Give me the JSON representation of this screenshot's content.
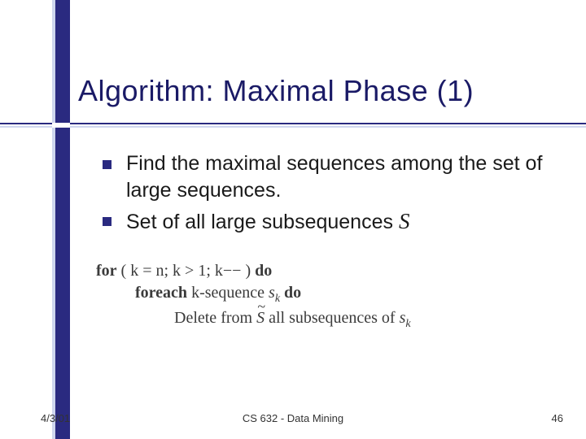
{
  "title": "Algorithm: Maximal Phase (1)",
  "bullets": [
    {
      "text": "Find the maximal sequences among the set of large sequences."
    },
    {
      "text_prefix": "Set of all large subsequences ",
      "math": "S"
    }
  ],
  "algorithm": {
    "line1_a": "for",
    "line1_b": " ( k = n; k > 1; k−− ) ",
    "line1_c": "do",
    "line2_a": "foreach",
    "line2_b": " k-sequence ",
    "line2_var": "s",
    "line2_sub": "k",
    "line2_c": " do",
    "line3_a": "Delete from ",
    "line3_S": "S",
    "line3_b": " all subsequences of ",
    "line3_var": "s",
    "line3_sub": "k"
  },
  "footer": {
    "date": "4/3/01",
    "course": "CS 632 - Data Mining",
    "page": "46"
  }
}
